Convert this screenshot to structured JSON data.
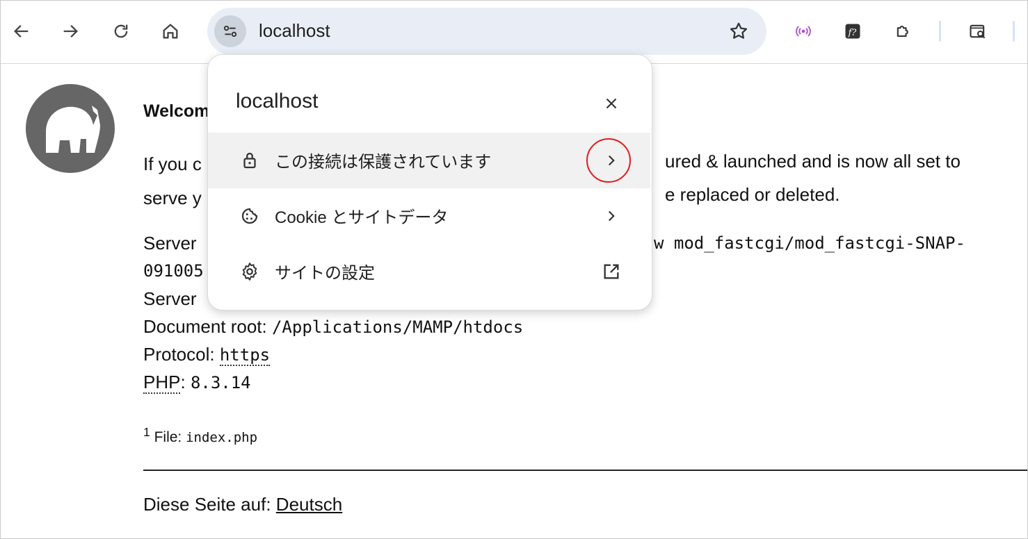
{
  "toolbar": {
    "url": "localhost",
    "back_icon": "arrow-back-icon",
    "forward_icon": "arrow-forward-icon",
    "reload_icon": "reload-icon",
    "home_icon": "home-icon",
    "site_info_icon": "tune-icon",
    "bookmark_icon": "star-icon",
    "extensions": [
      "broadcast-icon",
      "font-finder-icon",
      "puzzle-icon",
      "search-page-icon"
    ]
  },
  "page": {
    "welcome": "Welcome",
    "para_line1_left": "If you c",
    "para_line1_right": "ured & launched and is now all set to",
    "para_line2_left": "serve y",
    "para_line2_right": "e replaced or deleted.",
    "server_label": "Server",
    "server_value_tail": "w mod_fastcgi/mod_fastcgi-SNAP-",
    "server_line2": "091005",
    "server2_label": "Server ",
    "docroot_label": "Document root:",
    "docroot_value": "/Applications/MAMP/htdocs",
    "protocol_label": "Protocol:",
    "protocol_value": "https",
    "php_label": "PHP",
    "php_sep": ":",
    "php_value": "8.3.14",
    "footnote_num": "1",
    "footnote_label": "File:",
    "footnote_value": "index.php",
    "lang_label": "Diese Seite auf:",
    "lang_link": "Deutsch"
  },
  "popup": {
    "title": "localhost",
    "close_icon": "close-icon",
    "items": [
      {
        "label": "この接続は保護されています",
        "icon": "lock-icon",
        "end_icon": "chevron-right-icon",
        "highlighted": true
      },
      {
        "label": "Cookie とサイトデータ",
        "icon": "cookie-icon",
        "end_icon": "chevron-right-icon",
        "highlighted": false
      },
      {
        "label": "サイトの設定",
        "icon": "gear-icon",
        "end_icon": "open-in-new-icon",
        "highlighted": false
      }
    ]
  },
  "colors": {
    "omnibox_bg": "#e9eef6",
    "popup_highlight": "#f1f1f1",
    "annotation_circle": "#e01b1b",
    "logo_gray": "#666666",
    "broadcast_purple": "#b04bd6"
  }
}
